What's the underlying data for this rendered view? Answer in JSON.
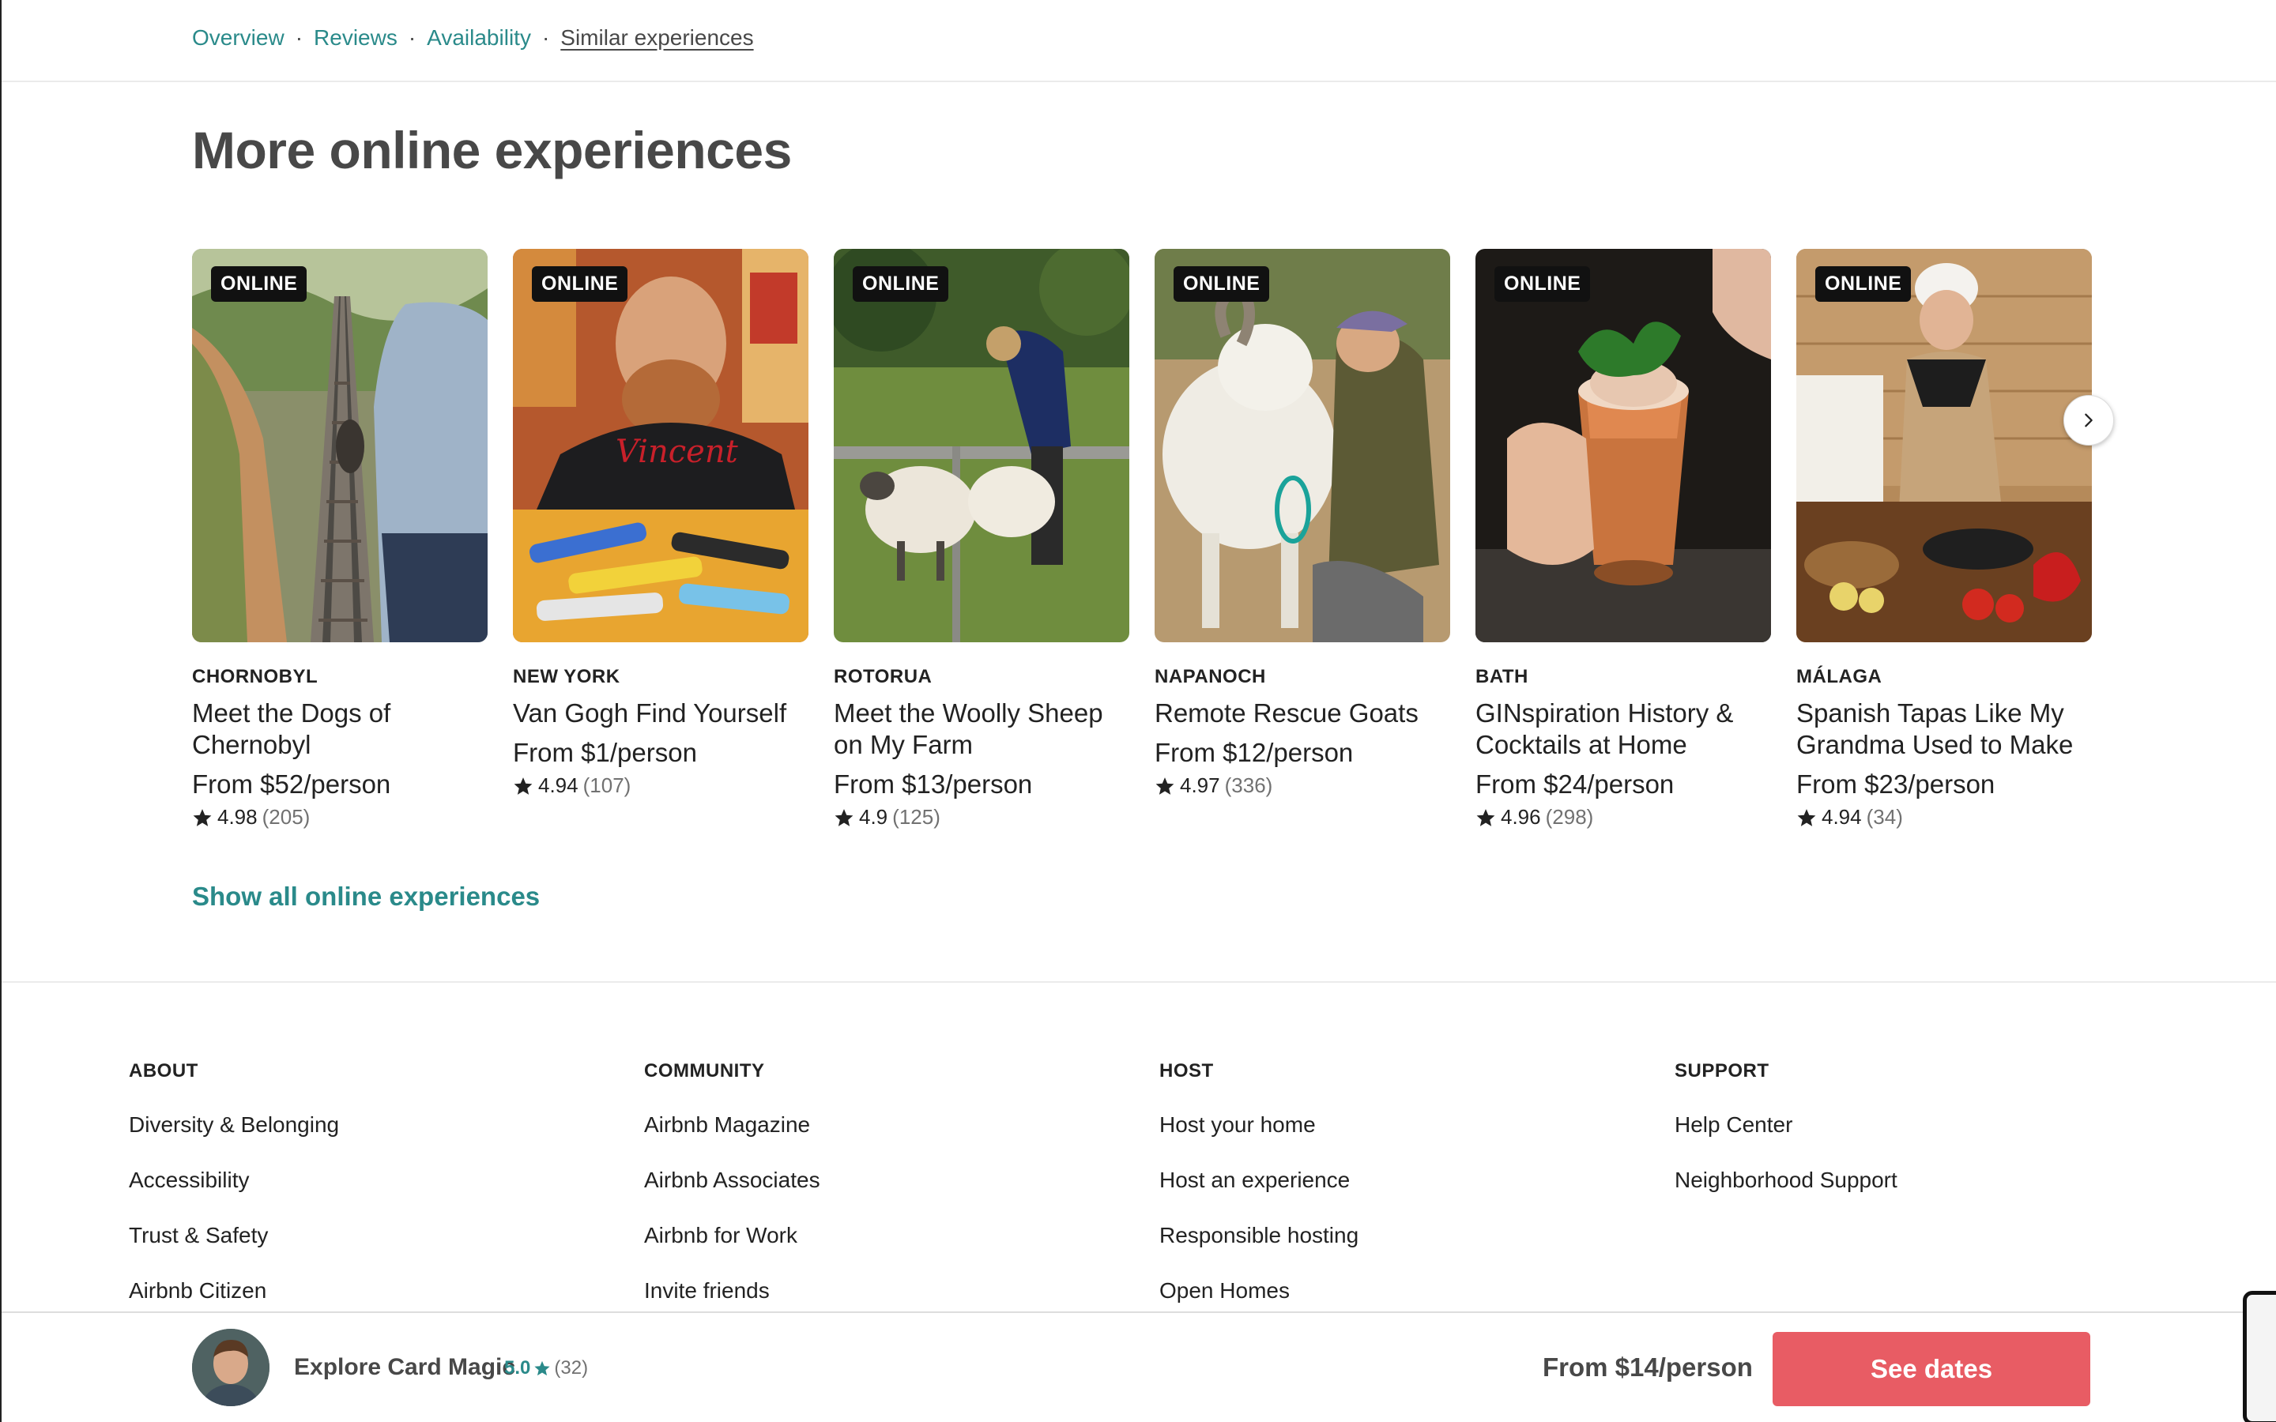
{
  "subnav": {
    "links": [
      {
        "label": "Overview",
        "active": false
      },
      {
        "label": "Reviews",
        "active": false
      },
      {
        "label": "Availability",
        "active": false
      },
      {
        "label": "Similar experiences",
        "active": true
      }
    ],
    "separator": "·"
  },
  "section": {
    "title": "More online experiences",
    "show_all_label": "Show all online experiences"
  },
  "cards": [
    {
      "badge": "ONLINE",
      "location": "CHORNOBYL",
      "title": "Meet the Dogs of Chernobyl",
      "price": "From $52/person",
      "rating": "4.98",
      "reviews": "(205)"
    },
    {
      "badge": "ONLINE",
      "location": "NEW YORK",
      "title": "Van Gogh Find Yourself",
      "price": "From $1/person",
      "rating": "4.94",
      "reviews": "(107)"
    },
    {
      "badge": "ONLINE",
      "location": "ROTORUA",
      "title": "Meet the Woolly Sheep on My Farm",
      "price": "From $13/person",
      "rating": "4.9",
      "reviews": "(125)"
    },
    {
      "badge": "ONLINE",
      "location": "NAPANOCH",
      "title": "Remote Rescue Goats",
      "price": "From $12/person",
      "rating": "4.97",
      "reviews": "(336)"
    },
    {
      "badge": "ONLINE",
      "location": "BATH",
      "title": "GINspiration History & Cocktails at Home",
      "price": "From $24/person",
      "rating": "4.96",
      "reviews": "(298)"
    },
    {
      "badge": "ONLINE",
      "location": "MÁLAGA",
      "title": "Spanish Tapas Like My Grandma Used to Make",
      "price": "From $23/person",
      "rating": "4.94",
      "reviews": "(34)"
    }
  ],
  "footer": {
    "columns": [
      {
        "heading": "ABOUT",
        "items": [
          "Diversity & Belonging",
          "Accessibility",
          "Trust & Safety",
          "Airbnb Citizen"
        ]
      },
      {
        "heading": "COMMUNITY",
        "items": [
          "Airbnb Magazine",
          "Airbnb Associates",
          "Airbnb for Work",
          "Invite friends"
        ]
      },
      {
        "heading": "HOST",
        "items": [
          "Host your home",
          "Host an experience",
          "Responsible hosting",
          "Open Homes"
        ]
      },
      {
        "heading": "SUPPORT",
        "items": [
          "Help Center",
          "Neighborhood Support"
        ]
      }
    ]
  },
  "booking": {
    "title": "Explore Card Magic",
    "rating": "5.0",
    "reviews": "(32)",
    "price": "From $14/person",
    "cta": "See dates"
  },
  "colors": {
    "teal": "#2a8a8a",
    "cta": "#e85c64",
    "text": "#222222",
    "muted": "#717171"
  },
  "icons": {
    "star": "star-icon",
    "next": "chevron-right-icon"
  }
}
